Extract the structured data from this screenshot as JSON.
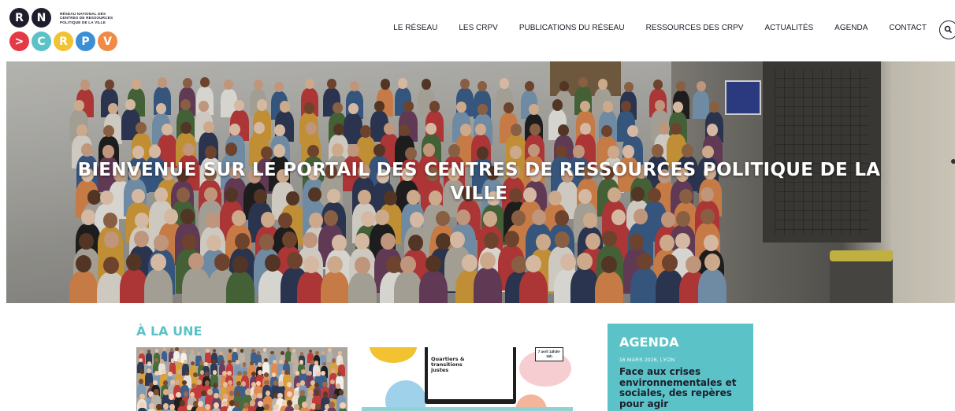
{
  "logo": {
    "letters_top": [
      "R",
      "N"
    ],
    "letters_bottom": [
      ">",
      "C",
      "R",
      "P",
      "V"
    ],
    "colors_top": [
      "#1d1d2b",
      "#1d1d2b"
    ],
    "colors_bottom": [
      "#e63946",
      "#5bc3c7",
      "#f2c230",
      "#3b8fd6",
      "#f08a45"
    ],
    "subtitle": "RÉSEAU NATIONAL DES CENTRES DE RESSOURCES POLITIQUE DE LA VILLE"
  },
  "nav": {
    "items": [
      "LE RÉSEAU",
      "LES CRPV",
      "PUBLICATIONS DU RÉSEAU",
      "RESSOURCES DES CRPV",
      "ACTUALITÉS",
      "AGENDA",
      "CONTACT"
    ],
    "search_icon": "search-icon"
  },
  "hero": {
    "title": "BIENVENUE SUR LE PORTAIL DES CENTRES DE RESSOURCES POLITIQUE DE LA VILLE"
  },
  "main": {
    "section_title": "À LA UNE",
    "card2": {
      "poster_title": "Quartiers & transitions justes",
      "date_badge": "7 avril 14h30-16h"
    }
  },
  "agenda": {
    "title": "AGENDA",
    "date": "16 MARS 2026, LYON",
    "event": "Face aux crises environnementales et sociales, des repères pour agir"
  },
  "colors": {
    "accent": "#5bc3c7",
    "text": "#1d1d2b"
  }
}
